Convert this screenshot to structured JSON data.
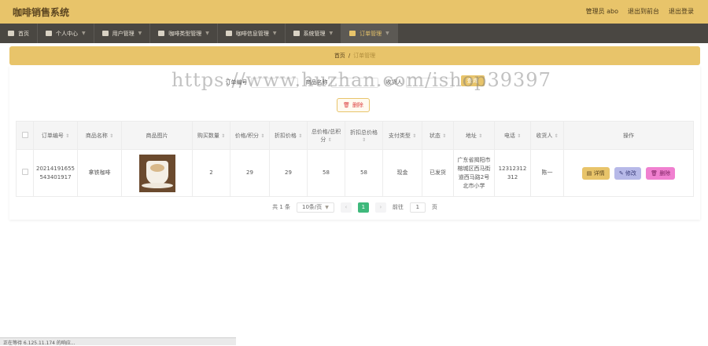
{
  "header": {
    "title": "咖啡销售系统",
    "user_label": "管理员 abo",
    "back_label": "退出到前台",
    "logout_label": "退出登录"
  },
  "nav": [
    {
      "label": "首页",
      "icon": "home-icon",
      "chevron": false
    },
    {
      "label": "个人中心",
      "icon": "user-icon",
      "chevron": true
    },
    {
      "label": "用户管理",
      "icon": "users-icon",
      "chevron": true
    },
    {
      "label": "咖啡类型管理",
      "icon": "category-icon",
      "chevron": true
    },
    {
      "label": "咖啡信息管理",
      "icon": "coffee-info-icon",
      "chevron": true
    },
    {
      "label": "系统管理",
      "icon": "system-icon",
      "chevron": true
    },
    {
      "label": "订单管理",
      "icon": "order-icon",
      "chevron": true,
      "active": true
    }
  ],
  "breadcrumb": {
    "home": "首页",
    "sep": "/",
    "current": "订单管理"
  },
  "search": {
    "field1_label": "订单编号",
    "field2_label": "商品名称",
    "field3_label": "收货人",
    "button": "查询"
  },
  "delete_button": "删除",
  "table": {
    "headers": [
      "订单编号",
      "商品名称",
      "商品图片",
      "购买数量",
      "价格/积分",
      "折扣价格",
      "总价格/总积分",
      "折扣总价格",
      "支付类型",
      "状态",
      "地址",
      "电话",
      "收货人",
      "操作"
    ],
    "row": {
      "order_no": "20214191655543401917",
      "name": "拿铁咖啡",
      "qty": "2",
      "price": "29",
      "discount_price": "29",
      "total": "58",
      "discount_total": "58",
      "pay_type": "现金",
      "status": "已发货",
      "address": "广东省揭阳市榕城区西马街道西马路2号北市小学",
      "phone": "12312312312",
      "receiver": "陈一",
      "op_detail": "详情",
      "op_edit": "修改",
      "op_delete": "删除"
    }
  },
  "pager": {
    "total": "共 1 条",
    "size": "10条/页",
    "page": "1",
    "goto": "前往",
    "goto_value": "1",
    "unit": "页"
  },
  "watermark": "https://www.huzhan.com/ishop39397",
  "statusbar": "正在等待 6.125.11.174 的响应...",
  "colors": {
    "brand": "#e8c46a",
    "nav_bg": "#4a4742",
    "page_active": "#3fb97c"
  }
}
